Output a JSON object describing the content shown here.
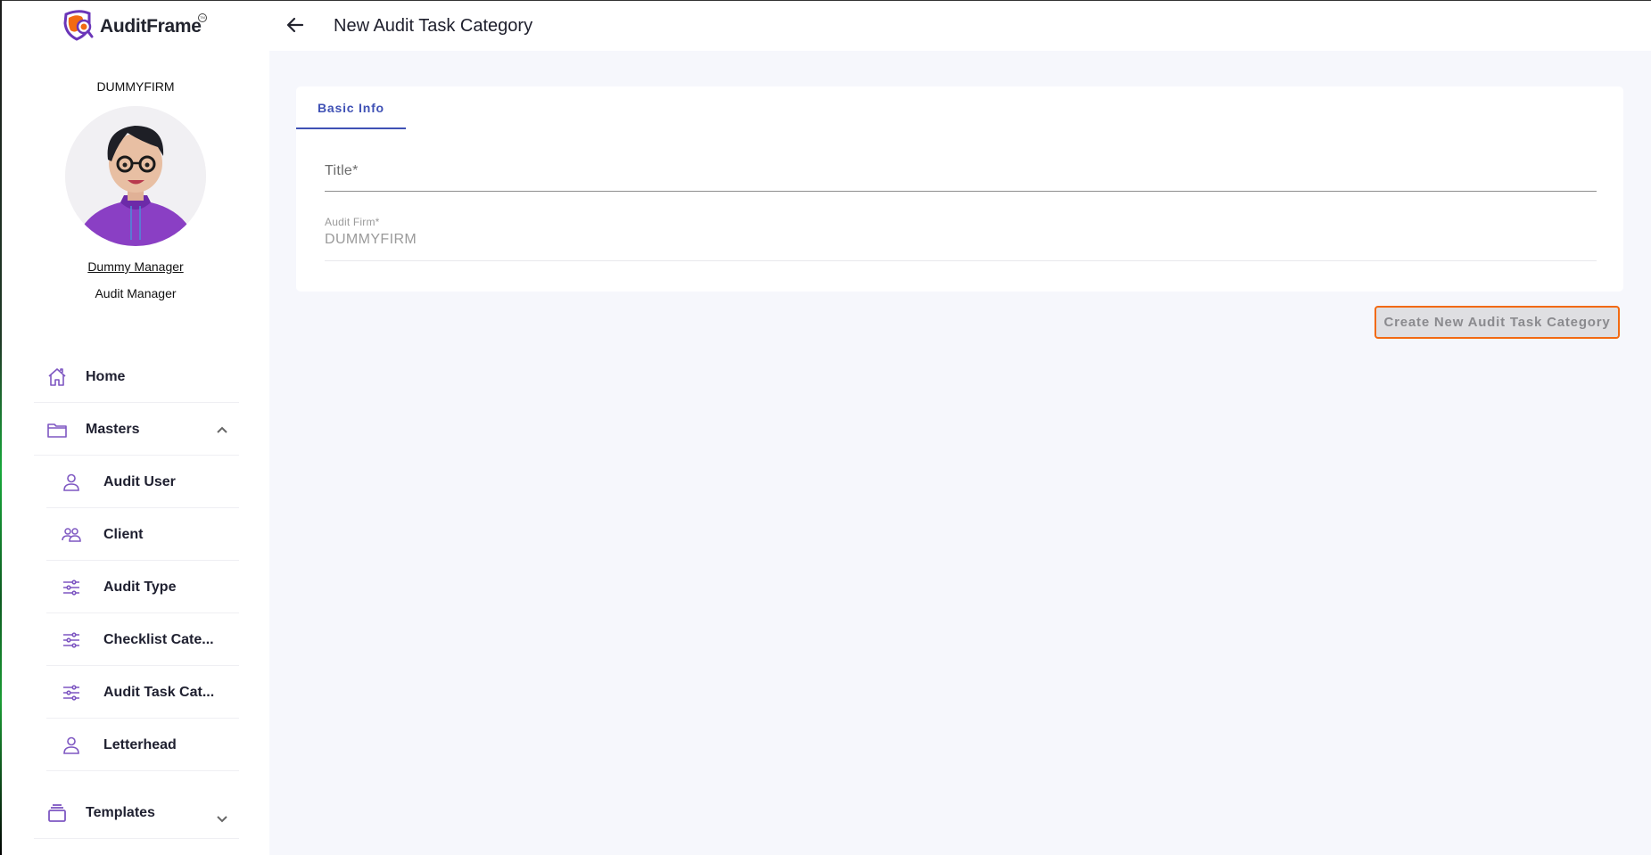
{
  "app": {
    "brand_name": "AuditFrame",
    "trademark": "TM",
    "accent_color": "#3f51b5",
    "icon_color": "#7e57c2",
    "button_border_color": "#f26a12"
  },
  "sidebar": {
    "firm_name": "DUMMYFIRM",
    "user_name": "Dummy Manager",
    "user_role": "Audit Manager",
    "nav": [
      {
        "label": "Home",
        "icon": "home-icon",
        "level": "top"
      },
      {
        "label": "Masters",
        "icon": "folder-icon",
        "level": "top",
        "expanded": true
      },
      {
        "label": "Audit User",
        "icon": "user-icon",
        "level": "sub"
      },
      {
        "label": "Client",
        "icon": "users-icon",
        "level": "sub"
      },
      {
        "label": "Audit Type",
        "icon": "sliders-icon",
        "level": "sub"
      },
      {
        "label": "Checklist Cate...",
        "icon": "sliders-icon",
        "level": "sub"
      },
      {
        "label": "Audit Task Cat...",
        "icon": "sliders-icon",
        "level": "sub"
      },
      {
        "label": "Letterhead",
        "icon": "user-icon",
        "level": "sub"
      },
      {
        "label": "Templates",
        "icon": "stack-icon",
        "level": "top",
        "expanded": false
      }
    ]
  },
  "header": {
    "back_icon": "arrow-left-icon",
    "title": "New Audit Task Category"
  },
  "form": {
    "tabs": [
      {
        "label": "Basic Info",
        "active": true
      }
    ],
    "title_field": {
      "label": "Title*",
      "value": ""
    },
    "firm_field": {
      "label": "Audit Firm*",
      "value": "DUMMYFIRM"
    },
    "submit_label": "Create New Audit Task Category"
  }
}
